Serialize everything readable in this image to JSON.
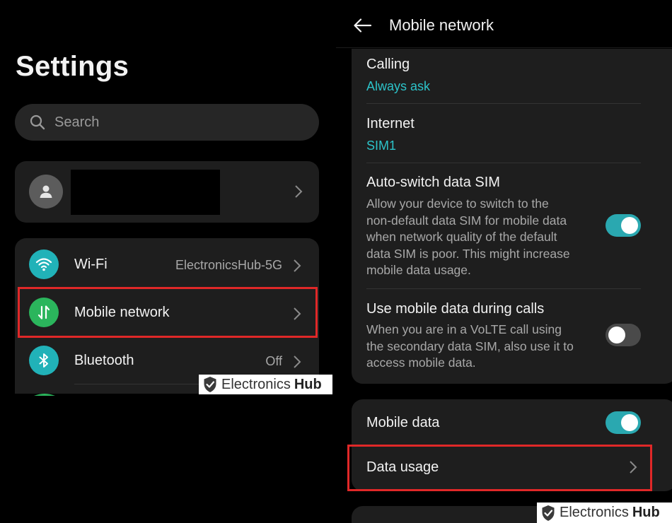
{
  "left_screen": {
    "title": "Settings",
    "search": {
      "placeholder": "Search",
      "icon": "search-icon"
    },
    "account": {
      "icon": "person-icon"
    },
    "items": [
      {
        "label": "Wi-Fi",
        "value": "ElectronicsHub-5G",
        "icon": "wifi-icon",
        "icon_color": "#21b2b8"
      },
      {
        "label": "Mobile network",
        "value": "",
        "icon": "mobile-data-arrows-icon",
        "icon_color": "#2bb55c",
        "highlighted": true
      },
      {
        "label": "Bluetooth",
        "value": "Off",
        "icon": "bluetooth-icon",
        "icon_color": "#21b2b8"
      }
    ]
  },
  "right_screen": {
    "title": "Mobile network",
    "back_icon": "back-arrow-icon",
    "calling": {
      "label": "Calling",
      "value": "Always ask"
    },
    "internet": {
      "label": "Internet",
      "value": "SIM1"
    },
    "auto_switch": {
      "label": "Auto-switch data SIM",
      "description_lines": [
        "Allow your device to switch to the",
        "non-default data SIM for mobile data",
        "when network quality of the default",
        "data SIM is poor. This might increase",
        "mobile data usage."
      ],
      "enabled": true
    },
    "calls_data": {
      "label": "Use mobile data during calls",
      "description_lines": [
        "When you are in a VoLTE call using",
        "the secondary data SIM, also use it to",
        "access mobile data."
      ],
      "enabled": false
    },
    "mobile_data": {
      "label": "Mobile data",
      "enabled": true
    },
    "data_usage": {
      "label": "Data usage",
      "highlighted": true
    }
  },
  "watermark": {
    "part1": "Electronics",
    "part2": "Hub"
  },
  "colors": {
    "accent": "#2cc3c9",
    "toggle_on": "#2aa8b0",
    "highlight_border": "#e02828",
    "card_bg": "#1e1e1e"
  }
}
